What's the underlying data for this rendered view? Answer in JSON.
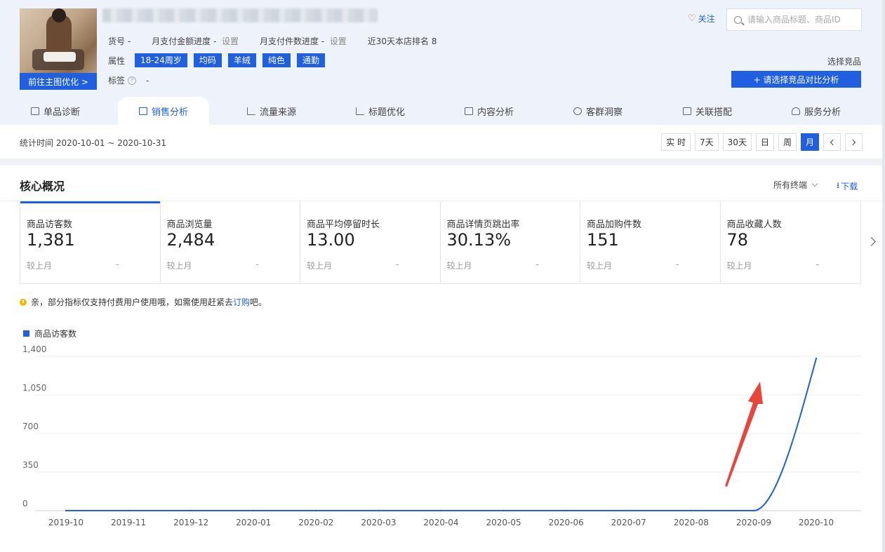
{
  "product": {
    "thumb_button": "前往主图优化 >",
    "code_label": "货号 -",
    "pay_amount_label": "月支付金额进度 -",
    "pay_amount_action": "设置",
    "pay_count_label": "月支付件数进度 -",
    "pay_count_action": "设置",
    "rank_label": "近30天本店排名 8",
    "attr_label": "属性",
    "attrs": [
      "18-24周岁",
      "均码",
      "羊绒",
      "纯色",
      "通勤"
    ],
    "tag_label": "标签",
    "tag_value": "-"
  },
  "header_right": {
    "follow": "关注",
    "search_placeholder": "请输入商品标题、商品ID",
    "compare_label": "选择竞品",
    "compare_button": "+ 请选择竞品对比分析"
  },
  "tabs": [
    {
      "label": "单品诊断",
      "icon": "bag-icon"
    },
    {
      "label": "销售分析",
      "icon": "bag-icon",
      "active": true
    },
    {
      "label": "流量来源",
      "icon": "line-chart-icon"
    },
    {
      "label": "标题优化",
      "icon": "line-chart-icon"
    },
    {
      "label": "内容分析",
      "icon": "document-icon"
    },
    {
      "label": "客群洞察",
      "icon": "users-icon"
    },
    {
      "label": "关联搭配",
      "icon": "link-icon"
    },
    {
      "label": "服务分析",
      "icon": "headset-icon"
    }
  ],
  "filter": {
    "stat_time": "统计时间 2020-10-01 ~ 2020-10-31",
    "periods": [
      "实 时",
      "7天",
      "30天",
      "日",
      "周",
      "月"
    ],
    "active_period": "月"
  },
  "core": {
    "title": "核心概况",
    "terminal": "所有终端",
    "download": "下载",
    "metrics": [
      {
        "name": "商品访客数",
        "value": "1,381",
        "compare": "较上月",
        "delta": "-"
      },
      {
        "name": "商品浏览量",
        "value": "2,484",
        "compare": "较上月",
        "delta": "-"
      },
      {
        "name": "商品平均停留时长",
        "value": "13.00",
        "compare": "较上月",
        "delta": "-"
      },
      {
        "name": "商品详情页跳出率",
        "value": "30.13%",
        "compare": "较上月",
        "delta": "-"
      },
      {
        "name": "商品加购件数",
        "value": "151",
        "compare": "较上月",
        "delta": "-"
      },
      {
        "name": "商品收藏人数",
        "value": "78",
        "compare": "较上月",
        "delta": "-"
      }
    ],
    "notice_prefix": "亲，部分指标仅支持付费用户使用哦，如需使用赶紧去",
    "notice_link": "订购",
    "notice_suffix": "吧。"
  },
  "colors": {
    "accent": "#1f5fe0",
    "arrow": "#e8453c"
  },
  "chart_data": {
    "type": "line",
    "legend": [
      "商品访客数"
    ],
    "categories": [
      "2019-10",
      "2019-11",
      "2019-12",
      "2020-01",
      "2020-02",
      "2020-03",
      "2020-04",
      "2020-05",
      "2020-06",
      "2020-07",
      "2020-08",
      "2020-09",
      "2020-10"
    ],
    "series": [
      {
        "name": "商品访客数",
        "values": [
          0,
          0,
          0,
          0,
          0,
          0,
          0,
          0,
          0,
          0,
          0,
          0,
          1381
        ]
      }
    ],
    "yticks": [
      "0",
      "350",
      "700",
      "1,050",
      "1,400"
    ],
    "ylim": [
      0,
      1400
    ],
    "grid": true,
    "legend_position": "top-left"
  }
}
